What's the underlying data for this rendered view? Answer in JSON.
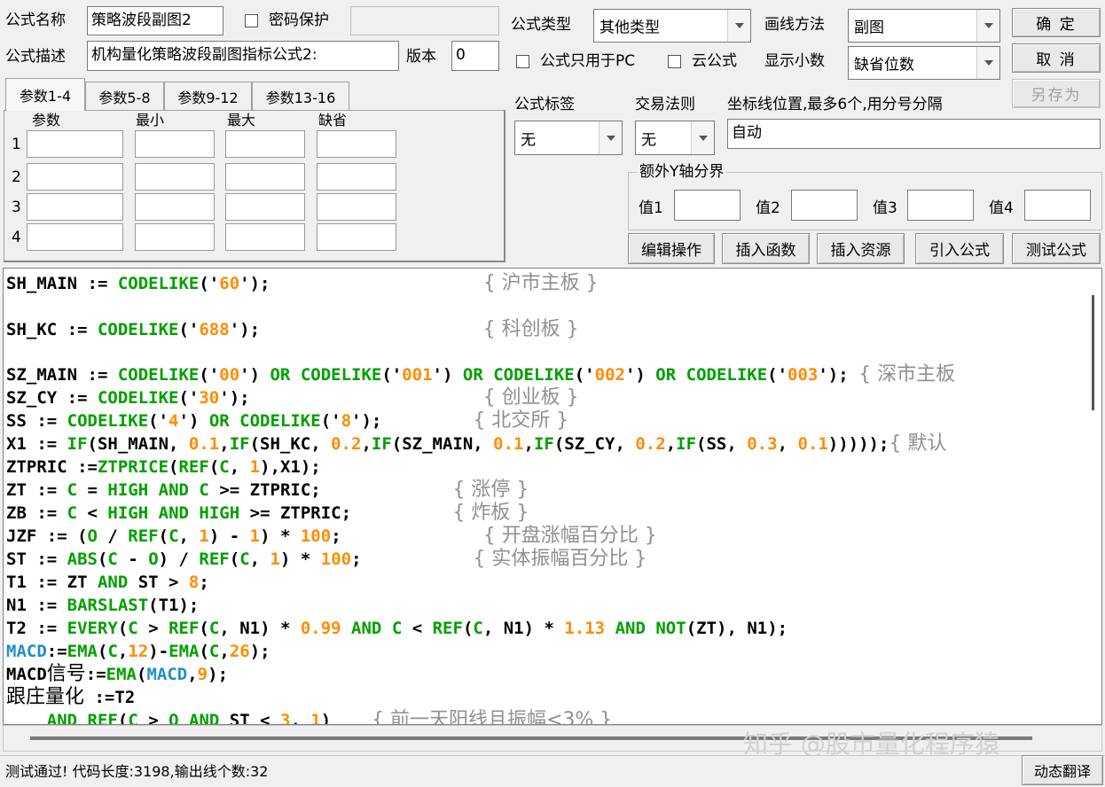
{
  "form": {
    "name_label": "公式名称",
    "name_value": "策略波段副图2",
    "password_label": "密码保护",
    "password_value": "",
    "desc_label": "公式描述",
    "desc_value": "机构量化策略波段副图指标公式2:",
    "version_label": "版本",
    "version_value": "0",
    "type_label": "公式类型",
    "type_value": "其他类型",
    "draw_label": "画线方法",
    "draw_value": "副图",
    "pc_only_label": "公式只用于PC",
    "cloud_label": "云公式",
    "decimal_label": "显示小数",
    "decimal_value": "缺省位数",
    "tag_label": "公式标签",
    "tag_value": "无",
    "trade_label": "交易法则",
    "trade_value": "无",
    "coord_label": "坐标线位置,最多6个,用分号分隔",
    "coord_value": "自动",
    "yaxis_group": "额外Y轴分界",
    "v1": "值1",
    "v2": "值2",
    "v3": "值3",
    "v4": "值4"
  },
  "buttons": {
    "ok": "确 定",
    "cancel": "取 消",
    "save_as": "另存为",
    "edit": "编辑操作",
    "insert_func": "插入函数",
    "insert_res": "插入资源",
    "import": "引入公式",
    "test": "测试公式",
    "translate": "动态翻译"
  },
  "tabs": [
    "参数1-4",
    "参数5-8",
    "参数9-12",
    "参数13-16"
  ],
  "params": {
    "headers": [
      "参数",
      "最小",
      "最大",
      "缺省"
    ],
    "rows": [
      "1",
      "2",
      "3",
      "4"
    ]
  },
  "status_text": "测试通过! 代码长度:3198,输出线个数:32",
  "watermark": "知乎 @股市量化程序猿",
  "code_comments": {
    "c1": "{ 沪市主板 }",
    "c2": "{ 科创板 }",
    "c3": "{ 深市主板",
    "c4": "{ 创业板 }",
    "c5": "{ 北交所 }",
    "c6": "{ 默认",
    "c7": "{ 涨停 }",
    "c8": "{ 炸板 }",
    "c9": "{ 开盘涨幅百分比 }",
    "c10": "{ 实体振幅百分比 }",
    "c11": "{ 前一天阳线且振幅<3% }",
    "sig": "信号",
    "zhuang": "跟庄量化"
  }
}
